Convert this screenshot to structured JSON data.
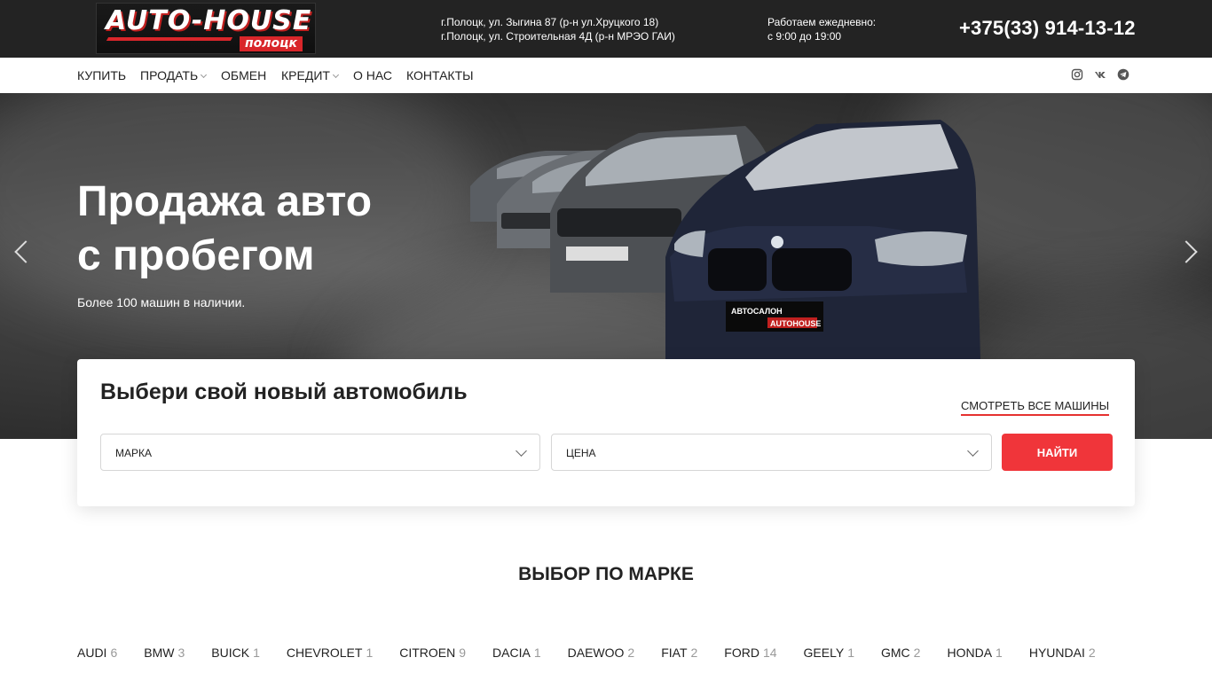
{
  "logo": {
    "main": "AUTO-HOUSE",
    "sub": "полоцк"
  },
  "header": {
    "address_lines": [
      "г.Полоцк, ул. Зыгина 87 (р-н ул.Хруцкого 18)",
      "г.Полоцк, ул. Строительная 4Д (р-н МРЭО ГАИ)"
    ],
    "hours_lines": [
      "Работаем ежедневно:",
      "с 9:00 до 19:00"
    ],
    "phone": "+375(33) 914-13-12"
  },
  "nav": {
    "items": [
      {
        "label": "КУПИТЬ"
      },
      {
        "label": "ПРОДАТЬ"
      },
      {
        "label": "ОБМЕН"
      },
      {
        "label": "КРЕДИТ"
      },
      {
        "label": "О НАС"
      },
      {
        "label": "КОНТАКТЫ"
      }
    ],
    "social": [
      "instagram-icon",
      "vk-icon",
      "telegram-icon"
    ]
  },
  "hero": {
    "title_line1": "Продажа авто",
    "title_line2": "с пробегом",
    "subtitle": "Более 100 машин в наличии.",
    "plate_text": "АВТОСАЛОН",
    "plate_brand": "AUTOHOUSE"
  },
  "search": {
    "title": "Выбери свой новый автомобиль",
    "see_all": "СМОТРЕТЬ ВСЕ МАШИНЫ",
    "brand_select": "МАРКА",
    "price_select": "ЦЕНА",
    "find_button": "НАЙТИ"
  },
  "brands_section": {
    "title": "ВЫБОР ПО МАРКЕ",
    "brands": [
      {
        "name": "AUDI",
        "count": "6"
      },
      {
        "name": "BMW",
        "count": "3"
      },
      {
        "name": "BUICK",
        "count": "1"
      },
      {
        "name": "CHEVROLET",
        "count": "1"
      },
      {
        "name": "CITROEN",
        "count": "9"
      },
      {
        "name": "DACIA",
        "count": "1"
      },
      {
        "name": "DAEWOO",
        "count": "2"
      },
      {
        "name": "FIAT",
        "count": "2"
      },
      {
        "name": "FORD",
        "count": "14"
      },
      {
        "name": "GEELY",
        "count": "1"
      },
      {
        "name": "GMC",
        "count": "2"
      },
      {
        "name": "HONDA",
        "count": "1"
      },
      {
        "name": "HYUNDAI",
        "count": "2"
      }
    ]
  },
  "colors": {
    "accent": "#f0353a",
    "topbar": "#232323"
  }
}
